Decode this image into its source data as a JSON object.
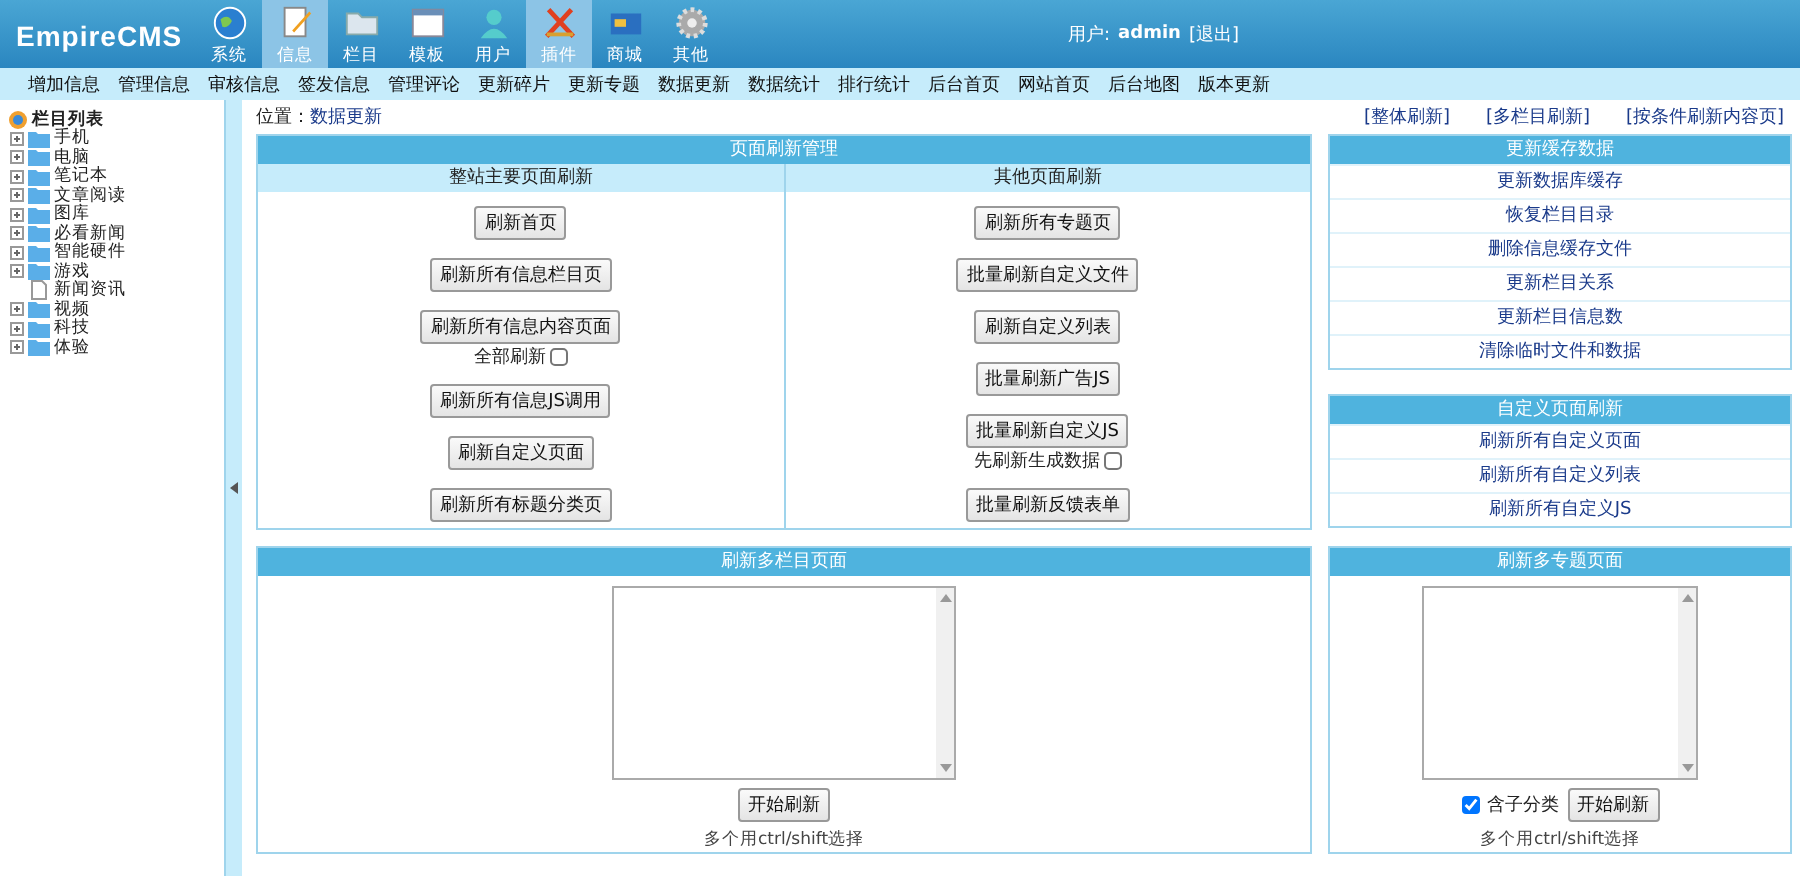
{
  "header": {
    "logo": "EmpireCMS",
    "nav": [
      {
        "label": "系统",
        "selected": false
      },
      {
        "label": "信息",
        "selected": true
      },
      {
        "label": "栏目",
        "selected": false
      },
      {
        "label": "模板",
        "selected": false
      },
      {
        "label": "用户",
        "selected": false
      },
      {
        "label": "插件",
        "selected": true
      },
      {
        "label": "商城",
        "selected": false
      },
      {
        "label": "其他",
        "selected": false
      }
    ],
    "user_label": "用户:",
    "user": "admin",
    "logout": "[退出]"
  },
  "menu": [
    "增加信息",
    "管理信息",
    "审核信息",
    "签发信息",
    "管理评论",
    "更新碎片",
    "更新专题",
    "数据更新",
    "数据统计",
    "排行统计",
    "后台首页",
    "网站首页",
    "后台地图",
    "版本更新"
  ],
  "sidebar": {
    "title": "栏目列表",
    "items": [
      {
        "label": "手机",
        "kind": "folder"
      },
      {
        "label": "电脑",
        "kind": "folder"
      },
      {
        "label": "笔记本",
        "kind": "folder"
      },
      {
        "label": "文章阅读",
        "kind": "folder"
      },
      {
        "label": "图库",
        "kind": "folder"
      },
      {
        "label": "必看新闻",
        "kind": "folder"
      },
      {
        "label": "智能硬件",
        "kind": "folder"
      },
      {
        "label": "游戏",
        "kind": "folder"
      },
      {
        "label": "新闻资讯",
        "kind": "page"
      },
      {
        "label": "视频",
        "kind": "folder"
      },
      {
        "label": "科技",
        "kind": "folder"
      },
      {
        "label": "体验",
        "kind": "folder"
      }
    ]
  },
  "breadcrumb": {
    "label": "位置：",
    "value": "数据更新"
  },
  "quick_links": [
    "[整体刷新]",
    "[多栏目刷新]",
    "[按条件刷新内容页]"
  ],
  "refresh_panel": {
    "title": "页面刷新管理",
    "columns": [
      {
        "heading": "整站主要页面刷新",
        "buttons": [
          {
            "label": "刷新首页"
          },
          {
            "label": "刷新所有信息栏目页"
          },
          {
            "label": "刷新所有信息内容页面",
            "option": {
              "label": "全部刷新",
              "checked": false
            }
          },
          {
            "label": "刷新所有信息JS调用"
          },
          {
            "label": "刷新自定义页面"
          },
          {
            "label": "刷新所有标题分类页"
          }
        ]
      },
      {
        "heading": "其他页面刷新",
        "buttons": [
          {
            "label": "刷新所有专题页"
          },
          {
            "label": "批量刷新自定义文件"
          },
          {
            "label": "刷新自定义列表"
          },
          {
            "label": "批量刷新广告JS"
          },
          {
            "label": "批量刷新自定义JS",
            "option": {
              "label": "先刷新生成数据",
              "checked": false
            }
          },
          {
            "label": "批量刷新反馈表单"
          }
        ]
      }
    ]
  },
  "cache_panel": {
    "title": "更新缓存数据",
    "links": [
      "更新数据库缓存",
      "恢复栏目目录",
      "删除信息缓存文件",
      "更新栏目关系",
      "更新栏目信息数",
      "清除临时文件和数据"
    ]
  },
  "custom_panel": {
    "title": "自定义页面刷新",
    "links": [
      "刷新所有自定义页面",
      "刷新所有自定义列表",
      "刷新所有自定义JS"
    ]
  },
  "multi_panels": [
    {
      "title": "刷新多栏目页面",
      "button": "开始刷新",
      "hint": "多个用ctrl/shift选择"
    },
    {
      "title": "刷新多专题页面",
      "option": {
        "label": "含子分类",
        "checked": true
      },
      "button": "开始刷新",
      "hint": "多个用ctrl/shift选择"
    }
  ]
}
